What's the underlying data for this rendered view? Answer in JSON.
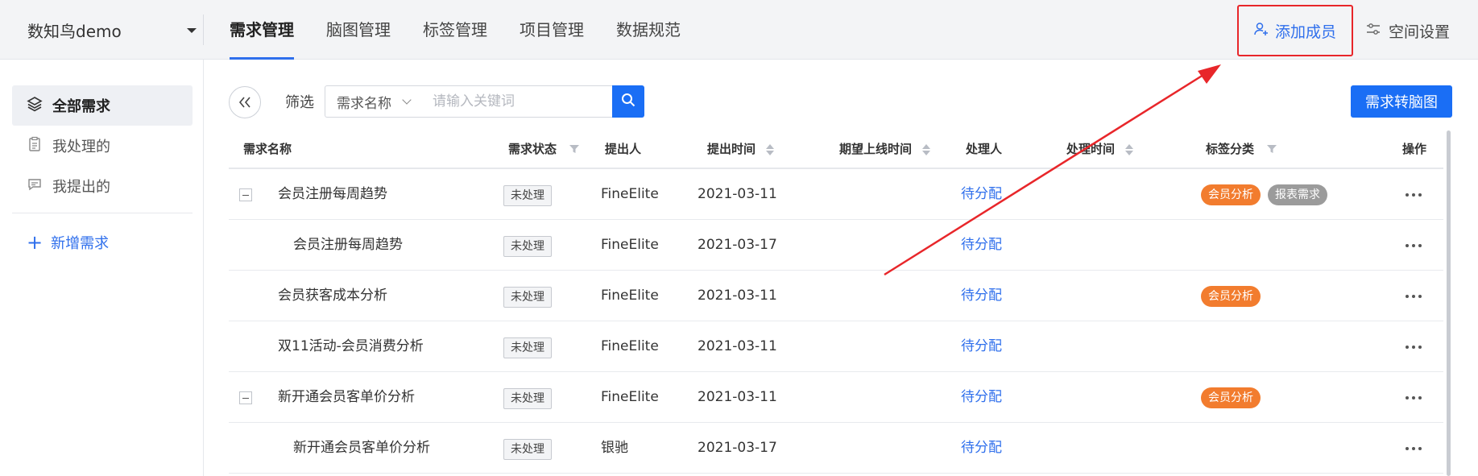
{
  "workspace": {
    "name": "数知鸟demo"
  },
  "nav": {
    "items": [
      {
        "label": "需求管理",
        "active": true
      },
      {
        "label": "脑图管理",
        "active": false
      },
      {
        "label": "标签管理",
        "active": false
      },
      {
        "label": "项目管理",
        "active": false
      },
      {
        "label": "数据规范",
        "active": false
      }
    ]
  },
  "top_actions": {
    "add_member": "添加成员",
    "space_settings": "空间设置"
  },
  "sidebar": {
    "items": [
      {
        "label": "全部需求",
        "icon": "layers-icon",
        "active": true
      },
      {
        "label": "我处理的",
        "icon": "clipboard-icon",
        "active": false
      },
      {
        "label": "我提出的",
        "icon": "chat-icon",
        "active": false
      }
    ],
    "add_label": "新增需求"
  },
  "filter": {
    "label": "筛选",
    "select_value": "需求名称",
    "placeholder": "请输入关键词",
    "mindmap_button": "需求转脑图"
  },
  "table": {
    "headers": {
      "name": "需求名称",
      "status": "需求状态",
      "proposer": "提出人",
      "submit_time": "提出时间",
      "expected_time": "期望上线时间",
      "handler": "处理人",
      "handle_time": "处理时间",
      "tags": "标签分类",
      "actions": "操作"
    },
    "rows": [
      {
        "name": "会员注册每周趋势",
        "child": false,
        "collapsible": true,
        "status": "未处理",
        "proposer": "FineElite",
        "submit_time": "2021-03-11",
        "handler": "待分配",
        "tags": [
          {
            "label": "会员分析",
            "color": "#f27c2e"
          },
          {
            "label": "报表需求",
            "color": "#9b9b9b"
          }
        ]
      },
      {
        "name": "会员注册每周趋势",
        "child": true,
        "collapsible": false,
        "status": "未处理",
        "proposer": "FineElite",
        "submit_time": "2021-03-17",
        "handler": "待分配",
        "tags": []
      },
      {
        "name": "会员获客成本分析",
        "child": false,
        "collapsible": false,
        "status": "未处理",
        "proposer": "FineElite",
        "submit_time": "2021-03-11",
        "handler": "待分配",
        "tags": [
          {
            "label": "会员分析",
            "color": "#f27c2e"
          }
        ]
      },
      {
        "name": "双11活动-会员消费分析",
        "child": false,
        "collapsible": false,
        "status": "未处理",
        "proposer": "FineElite",
        "submit_time": "2021-03-11",
        "handler": "待分配",
        "tags": []
      },
      {
        "name": "新开通会员客单价分析",
        "child": false,
        "collapsible": true,
        "status": "未处理",
        "proposer": "FineElite",
        "submit_time": "2021-03-11",
        "handler": "待分配",
        "tags": [
          {
            "label": "会员分析",
            "color": "#f27c2e"
          }
        ]
      },
      {
        "name": "新开通会员客单价分析",
        "child": true,
        "collapsible": false,
        "status": "未处理",
        "proposer": "银驰",
        "submit_time": "2021-03-17",
        "handler": "待分配",
        "tags": []
      }
    ]
  },
  "colors": {
    "accent": "#1a6ef5",
    "highlight_border": "#e8262a",
    "arrow": "#e8262a"
  }
}
